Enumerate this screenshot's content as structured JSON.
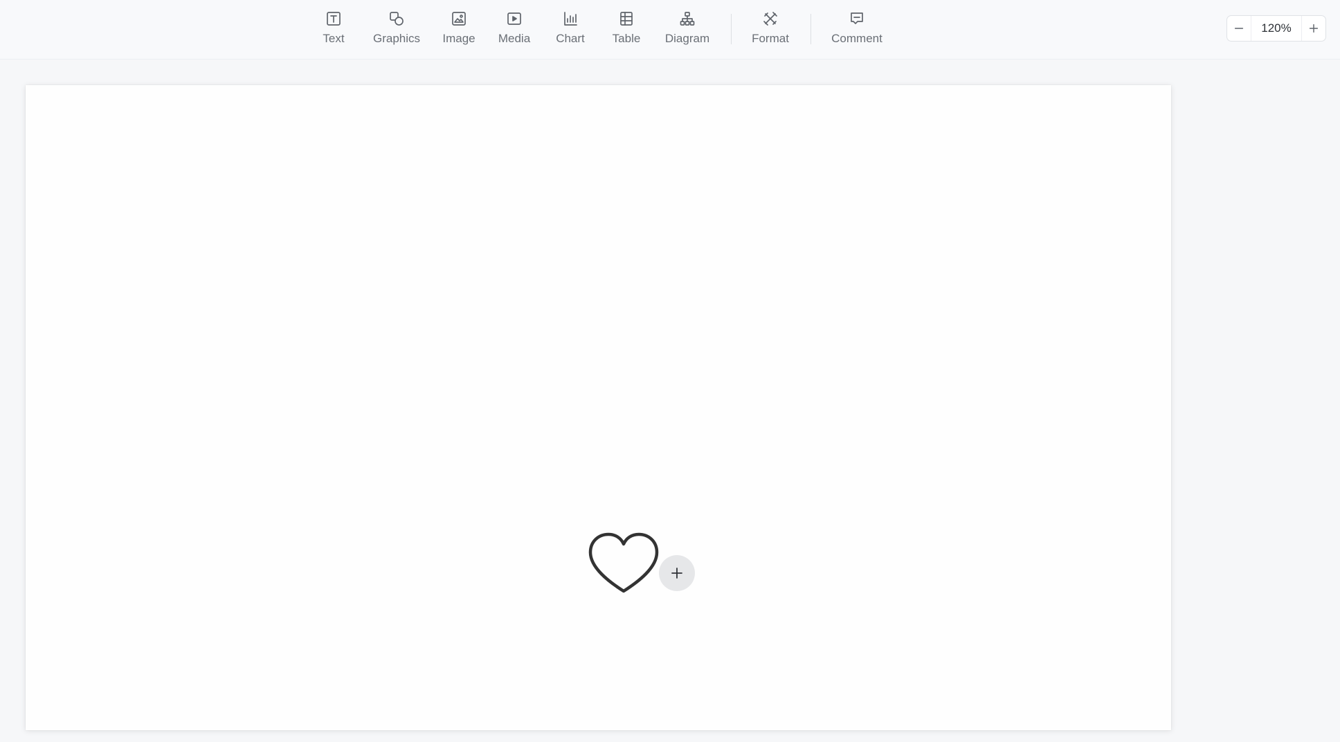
{
  "toolbar": {
    "items": [
      {
        "label": "Text",
        "icon": "text-box-icon"
      },
      {
        "label": "Graphics",
        "icon": "shapes-icon"
      },
      {
        "label": "Image",
        "icon": "image-icon"
      },
      {
        "label": "Media",
        "icon": "play-media-icon"
      },
      {
        "label": "Chart",
        "icon": "bar-chart-icon"
      },
      {
        "label": "Table",
        "icon": "table-icon"
      },
      {
        "label": "Diagram",
        "icon": "org-diagram-icon"
      },
      {
        "label": "Format",
        "icon": "format-tools-icon"
      },
      {
        "label": "Comment",
        "icon": "comment-icon"
      }
    ]
  },
  "zoom": {
    "value": "120%",
    "decrease_icon": "minus-icon",
    "increase_icon": "plus-icon"
  },
  "slide": {
    "shape_icon": "heart-icon",
    "add_button_icon": "plus-icon"
  }
}
